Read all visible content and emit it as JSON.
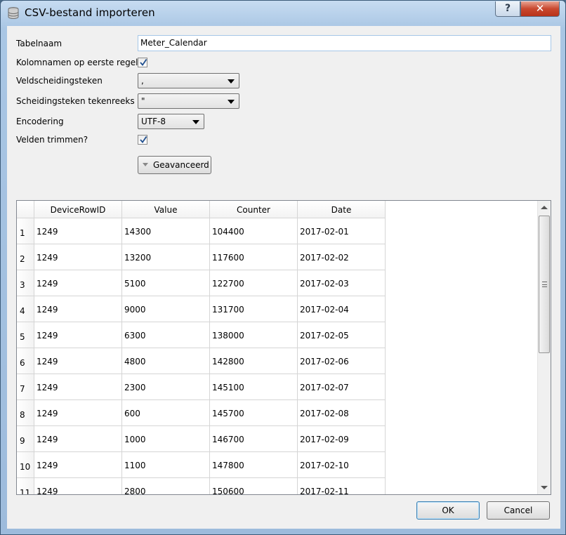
{
  "window": {
    "title": "CSV-bestand importeren",
    "help_symbol": "?",
    "close_symbol": "✕"
  },
  "form": {
    "table_name_label": "Tabelnaam",
    "table_name_value": "Meter_Calendar",
    "column_names_label": "Kolomnamen op eerste regel",
    "column_names_checked": true,
    "field_separator_label": "Veldscheidingsteken",
    "field_separator_value": ",",
    "quote_char_label": "Scheidingsteken tekenreeks",
    "quote_char_value": "\"",
    "encoding_label": "Encodering",
    "encoding_value": "UTF-8",
    "trim_fields_label": "Velden trimmen?",
    "trim_fields_checked": true,
    "advanced_label": "Geavanceerd"
  },
  "grid": {
    "columns": [
      "DeviceRowID",
      "Value",
      "Counter",
      "Date"
    ],
    "rows": [
      {
        "n": "1",
        "cells": [
          "1249",
          "14300",
          "104400",
          "2017-02-01"
        ]
      },
      {
        "n": "2",
        "cells": [
          "1249",
          "13200",
          "117600",
          "2017-02-02"
        ]
      },
      {
        "n": "3",
        "cells": [
          "1249",
          "5100",
          "122700",
          "2017-02-03"
        ]
      },
      {
        "n": "4",
        "cells": [
          "1249",
          "9000",
          "131700",
          "2017-02-04"
        ]
      },
      {
        "n": "5",
        "cells": [
          "1249",
          "6300",
          "138000",
          "2017-02-05"
        ]
      },
      {
        "n": "6",
        "cells": [
          "1249",
          "4800",
          "142800",
          "2017-02-06"
        ]
      },
      {
        "n": "7",
        "cells": [
          "1249",
          "2300",
          "145100",
          "2017-02-07"
        ]
      },
      {
        "n": "8",
        "cells": [
          "1249",
          "600",
          "145700",
          "2017-02-08"
        ]
      },
      {
        "n": "9",
        "cells": [
          "1249",
          "1000",
          "146700",
          "2017-02-09"
        ]
      },
      {
        "n": "10",
        "cells": [
          "1249",
          "1100",
          "147800",
          "2017-02-10"
        ]
      },
      {
        "n": "11",
        "cells": [
          "1249",
          "2800",
          "150600",
          "2017-02-11"
        ]
      }
    ]
  },
  "buttons": {
    "ok_label": "OK",
    "cancel_label": "Cancel"
  },
  "icons": {
    "title": "database-icon",
    "checkmark": "checkmark-icon",
    "dropdown": "chevron-down-icon"
  }
}
